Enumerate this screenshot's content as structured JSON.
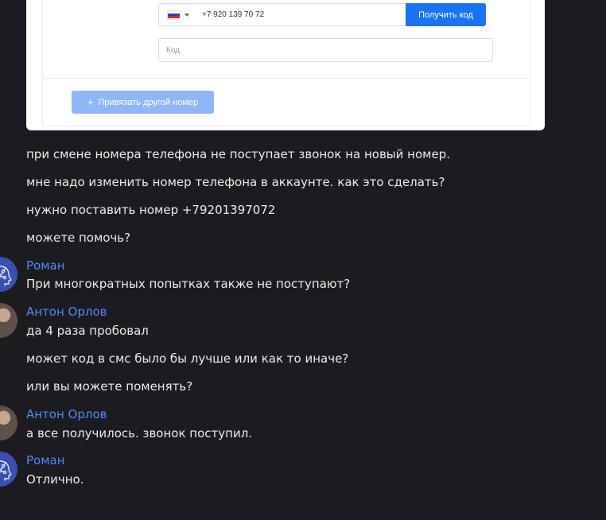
{
  "card": {
    "phone_value": "+7 920 139 70 72",
    "get_code_label": "Получить код",
    "code_placeholder": "Код",
    "bind_other_label": "Привязать другой номер",
    "accent_color": "#1a73f0"
  },
  "messages": [
    {
      "text": "при смене номера телефона не поступает звонок на новый номер."
    },
    {
      "text": "мне надо изменить номер телефона в аккаунте. как это сделать?"
    },
    {
      "text": "нужно поставить номер +79201397072"
    },
    {
      "text": "можете помочь?"
    },
    {
      "author": "Роман",
      "text": "При многократных попытках также не поступают?"
    },
    {
      "author": "Антон Орлов",
      "text": "да 4 раза пробовал"
    },
    {
      "text": "может код в смс было бы лучше или как то иначе?"
    },
    {
      "text": "или вы можете поменять?"
    },
    {
      "author": "Антон Орлов",
      "text": "а все получилось. звонок поступил."
    },
    {
      "author": "Роман",
      "text": "Отлично."
    }
  ],
  "colors": {
    "background": "#1c1b20",
    "author_name": "#4f8cf7",
    "message_text": "#ececec"
  }
}
